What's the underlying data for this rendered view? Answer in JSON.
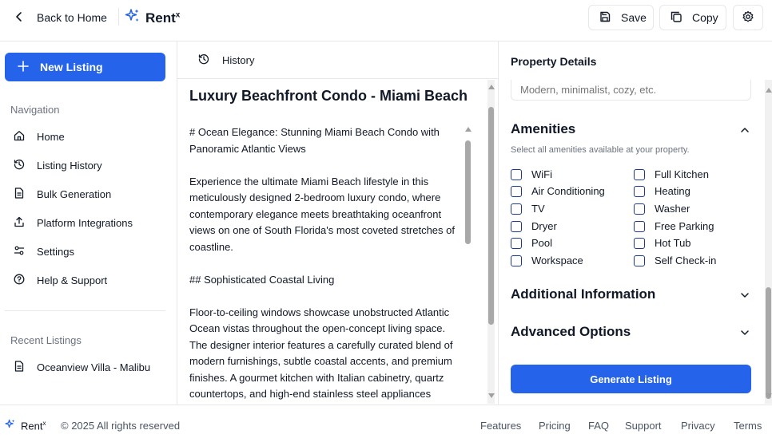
{
  "header": {
    "back_label": "Back to Home",
    "brand": "Rent",
    "brand_sup": "x",
    "save_label": "Save",
    "copy_label": "Copy"
  },
  "sidebar": {
    "new_listing_label": "New Listing",
    "nav_heading": "Navigation",
    "items": [
      {
        "label": "Home",
        "icon": "home-icon"
      },
      {
        "label": "Listing History",
        "icon": "history-icon"
      },
      {
        "label": "Bulk Generation",
        "icon": "document-icon"
      },
      {
        "label": "Platform Integrations",
        "icon": "share-icon"
      },
      {
        "label": "Settings",
        "icon": "settings-sliders-icon"
      },
      {
        "label": "Help & Support",
        "icon": "help-icon"
      }
    ],
    "recent_heading": "Recent Listings",
    "recent": [
      {
        "label": "Oceanview Villa - Malibu"
      }
    ]
  },
  "main": {
    "history_label": "History",
    "listing_title": "Luxury Beachfront Condo - Miami Beach",
    "paragraphs": [
      "# Ocean Elegance: Stunning Miami Beach Condo with Panoramic Atlantic Views",
      "Experience the ultimate Miami Beach lifestyle in this meticulously designed 2-bedroom luxury condo, where contemporary elegance meets breathtaking oceanfront views on one of South Florida's most coveted stretches of coastline.",
      "## Sophisticated Coastal Living",
      "Floor-to-ceiling windows showcase unobstructed Atlantic Ocean vistas throughout the open-concept living space. The designer interior features a carefully curated blend of modern furnishings, subtle coastal accents, and premium finishes. A gourmet kitchen with Italian cabinetry, quartz countertops, and high-end stainless steel appliances makes entertaining effortless."
    ]
  },
  "details": {
    "title": "Property Details",
    "style_placeholder": "Modern, minimalist, cozy, etc.",
    "amenities_title": "Amenities",
    "amenities_desc": "Select all amenities available at your property.",
    "amenities_left": [
      "WiFi",
      "Air Conditioning",
      "TV",
      "Dryer",
      "Pool",
      "Workspace"
    ],
    "amenities_right": [
      "Full Kitchen",
      "Heating",
      "Washer",
      "Free Parking",
      "Hot Tub",
      "Self Check-in"
    ],
    "additional_title": "Additional Information",
    "advanced_title": "Advanced Options",
    "generate_label": "Generate Listing"
  },
  "footer": {
    "brand": "Rent",
    "brand_sup": "x",
    "copyright": "© 2025 All rights reserved",
    "links": [
      "Features",
      "Pricing",
      "FAQ",
      "Support",
      "Privacy",
      "Terms"
    ]
  },
  "colors": {
    "accent": "#2563eb",
    "border": "#e5e7eb"
  }
}
